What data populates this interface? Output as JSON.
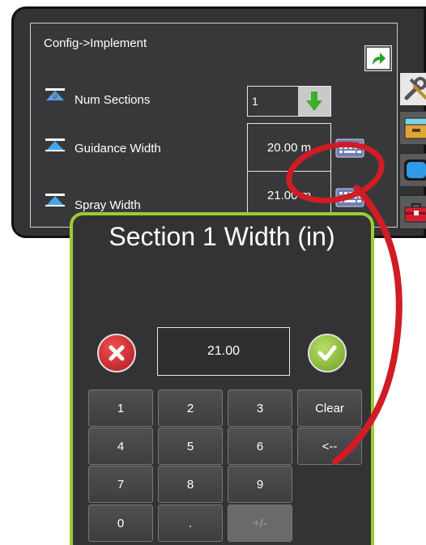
{
  "breadcrumb": "Config->Implement",
  "rows": [
    {
      "label": "Num Sections",
      "value": "1"
    },
    {
      "label": "Guidance Width",
      "value": "20.00 m"
    },
    {
      "label": "Spray Width",
      "value": "21.00 m"
    }
  ],
  "side_tabs": [
    {
      "icon": "wrench-screwdriver-icon",
      "active": true
    },
    {
      "icon": "storage-drawer-icon",
      "active": false
    },
    {
      "icon": "display-screen-icon",
      "active": false
    },
    {
      "icon": "toolbox-icon",
      "active": false
    }
  ],
  "keypad": {
    "title": "Section 1 Width (in)",
    "display_value": "21.00",
    "keys": [
      "1",
      "2",
      "3",
      "Clear",
      "4",
      "5",
      "6",
      "<--",
      "7",
      "8",
      "9",
      "0",
      ".",
      "+/-"
    ]
  },
  "colors": {
    "accent_green": "#9acd32",
    "cancel_red": "#c82028",
    "highlight_red": "#d01c24"
  }
}
